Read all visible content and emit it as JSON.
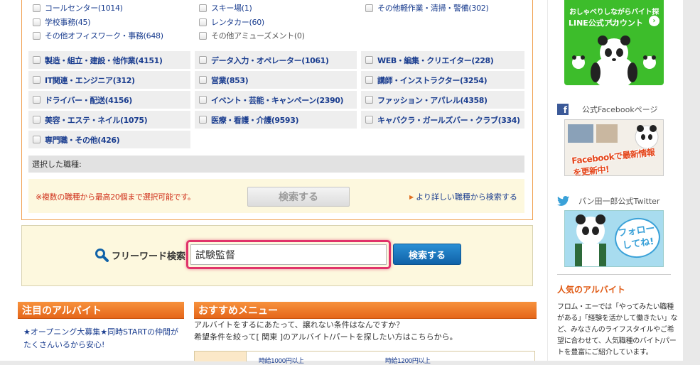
{
  "top_checks": [
    {
      "label": "コールセンター(1014)",
      "gray": false
    },
    {
      "label": "スキー場(1)",
      "gray": false
    },
    {
      "label": "その他軽作業・清掃・警備(302)",
      "gray": false
    },
    {
      "label": "学校事務(45)",
      "gray": false
    },
    {
      "label": "レンタカー(60)",
      "gray": false
    },
    {
      "label": "その他オフィスワーク・事務(648)",
      "gray": false
    },
    {
      "label": "その他アミューズメント(0)",
      "gray": true
    }
  ],
  "categories": [
    "製造・組立・建設・他作業(4151)",
    "データ入力・オペレーター(1061)",
    "WEB・編集・クリエイター(228)",
    "IT関連・エンジニア(312)",
    "営業(853)",
    "講師・インストラクター(3254)",
    "ドライバー・配送(4156)",
    "イベント・芸能・キャンペーン(2390)",
    "ファッション・アパレル(4358)",
    "美容・エステ・ネイル(1075)",
    "医療・看護・介護(9593)",
    "キャバクラ・ガールズバー・クラブ(334)",
    "専門職・その他(426)"
  ],
  "selected_label": "選択した職種:",
  "note": "※複数の職種から最高20個まで選択可能です。",
  "search_button_disabled": "検索する",
  "detail_link": "より詳しい職種から検索する",
  "freeword": {
    "label": "フリーワード検索",
    "value": "試験監督",
    "button": "検索する"
  },
  "chumoku": {
    "title": "注目のアルバイト",
    "text": "★オープニング大募集★同時STARTの仲間がたくさんいるから安心!"
  },
  "osusume": {
    "title": "おすすめメニュー",
    "line1": "アルバイトをするにあたって、譲れない条件はなんですか？",
    "line2": "希望条件を絞って[ 関東 ]のアルバイト/パートを探したい方はこちらから。",
    "cut1": "時給1000円以上",
    "cut2": "時給1200円以上"
  },
  "sidebar": {
    "line_text1": "おしゃべりしながらバイト探し!",
    "line_text2": "LINE公式アカウント",
    "facebook_label": "公式Facebookページ",
    "facebook_banner": "Facebookで最新情報を更新中!",
    "twitter_label": "パン田一郎公式Twitter",
    "twitter_banner": "フォローしてね!",
    "popular_title": "人気のアルバイト",
    "popular_text": "フロム・エーでは「やってみたい職種がある」「経験を活かして働きたい」など、みなさんのライフスタイルやご希望に合わせて、人気職種のバイト/パートを豊富にご紹介しています。"
  },
  "colors": {
    "accent_orange": "#e5661a",
    "link_blue": "#1a3d8f",
    "highlight_pink": "#e0336a",
    "button_blue": "#1062a8",
    "line_green": "#3dbd2b"
  }
}
